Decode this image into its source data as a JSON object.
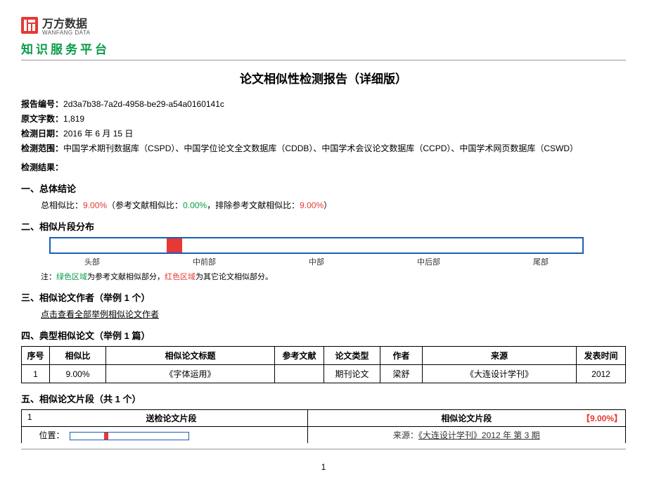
{
  "brand": {
    "cn": "万方数据",
    "en": "WANFANG DATA",
    "subtitle": "知识服务平台"
  },
  "report_title": "论文相似性检测报告（详细版）",
  "meta": {
    "id_label": "报告编号：",
    "id_value": "2d3a7b38-7a2d-4958-be29-a54a0160141c",
    "wc_label": "原文字数：",
    "wc_value": "1,819",
    "date_label": "检测日期：",
    "date_value": "2016 年 6 月 15 日",
    "scope_label": "检测范围：",
    "scope_value": "中国学术期刊数据库（CSPD）、中国学位论文全文数据库（CDDB）、中国学术会议论文数据库（CCPD）、中国学术网页数据库（CSWD）",
    "result_label": "检测结果："
  },
  "sections": {
    "s1": "一、总体结论",
    "s2": "二、相似片段分布",
    "s3": "三、相似论文作者（举例 1 个）",
    "s4": "四、典型相似论文（举例 1 篇）",
    "s5": "五、相似论文片段（共 1 个）"
  },
  "conclusion": {
    "prefix": "总相似比：",
    "total": "9.00%",
    "ref_prefix": "（参考文献相似比：",
    "ref": "0.00%",
    "excl_prefix": "，排除参考文献相似比：",
    "excl": "9.00%",
    "suffix": "）"
  },
  "dist_labels": [
    "头部",
    "中前部",
    "中部",
    "中后部",
    "尾部"
  ],
  "note": {
    "pre": "注：",
    "green": "绿色区域",
    "mid": "为参考文献相似部分，",
    "red": "红色区域",
    "post": "为其它论文相似部分。"
  },
  "authors_link": "点击查看全部举例相似论文作者",
  "table": {
    "headers": {
      "no": "序号",
      "ratio": "相似比",
      "title": "相似论文标题",
      "ref": "参考文献",
      "type": "论文类型",
      "author": "作者",
      "source": "来源",
      "pub": "发表时间"
    },
    "rows": [
      {
        "no": "1",
        "ratio": "9.00%",
        "title": "《字体运用》",
        "ref": "",
        "type": "期刊论文",
        "author": "梁舒",
        "source": "《大连设计学刊》",
        "pub": "2012"
      }
    ]
  },
  "fragment": {
    "num": "1",
    "left_header": "送检论文片段",
    "right_header": "相似论文片段",
    "pct": "【9.00%】",
    "loc_label": "位置：",
    "source_label": "来源：",
    "source_value": "《大连设计学刊》2012 年 第 3 期"
  },
  "page_number": "1"
}
